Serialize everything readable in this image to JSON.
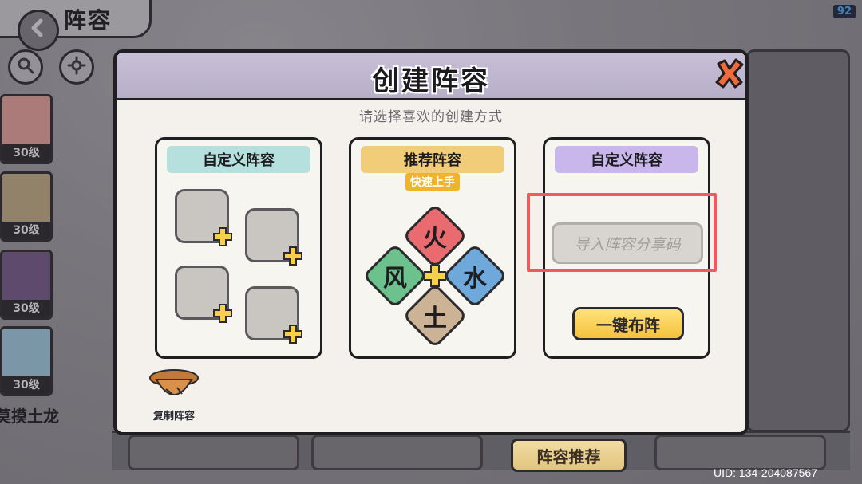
{
  "header": {
    "title": "阵容"
  },
  "fps": "92",
  "heroes": [
    {
      "level": "30级",
      "color": "#f0a9a1"
    },
    {
      "level": "30级",
      "color": "#c9b48a"
    },
    {
      "level": "30级",
      "color": "#7c5f8f"
    },
    {
      "level": "30级",
      "color": "#a8d3e8"
    }
  ],
  "hero_bottom_name": "莫摸土龙",
  "modal": {
    "title": "创建阵容",
    "subtitle": "请选择喜欢的创建方式",
    "cards": {
      "custom": {
        "banner": "自定义阵容"
      },
      "recommend": {
        "banner": "推荐阵容",
        "badge": "快速上手",
        "elements": {
          "fire": "火",
          "wind": "风",
          "water": "水",
          "earth": "土"
        }
      },
      "import": {
        "banner": "自定义阵容",
        "input_placeholder": "导入阵容分享码",
        "button": "一键布阵"
      }
    },
    "copy_team_label": "复制阵容"
  },
  "bottom_button": "阵容推荐",
  "uid": "UID: 134-204087567",
  "colors": {
    "fire": "#e96b6f",
    "wind": "#6cc18d",
    "water": "#6fa9dc",
    "earth": "#cdb395",
    "highlight": "#f05a5e",
    "accent_gold": "#f4c23c"
  }
}
